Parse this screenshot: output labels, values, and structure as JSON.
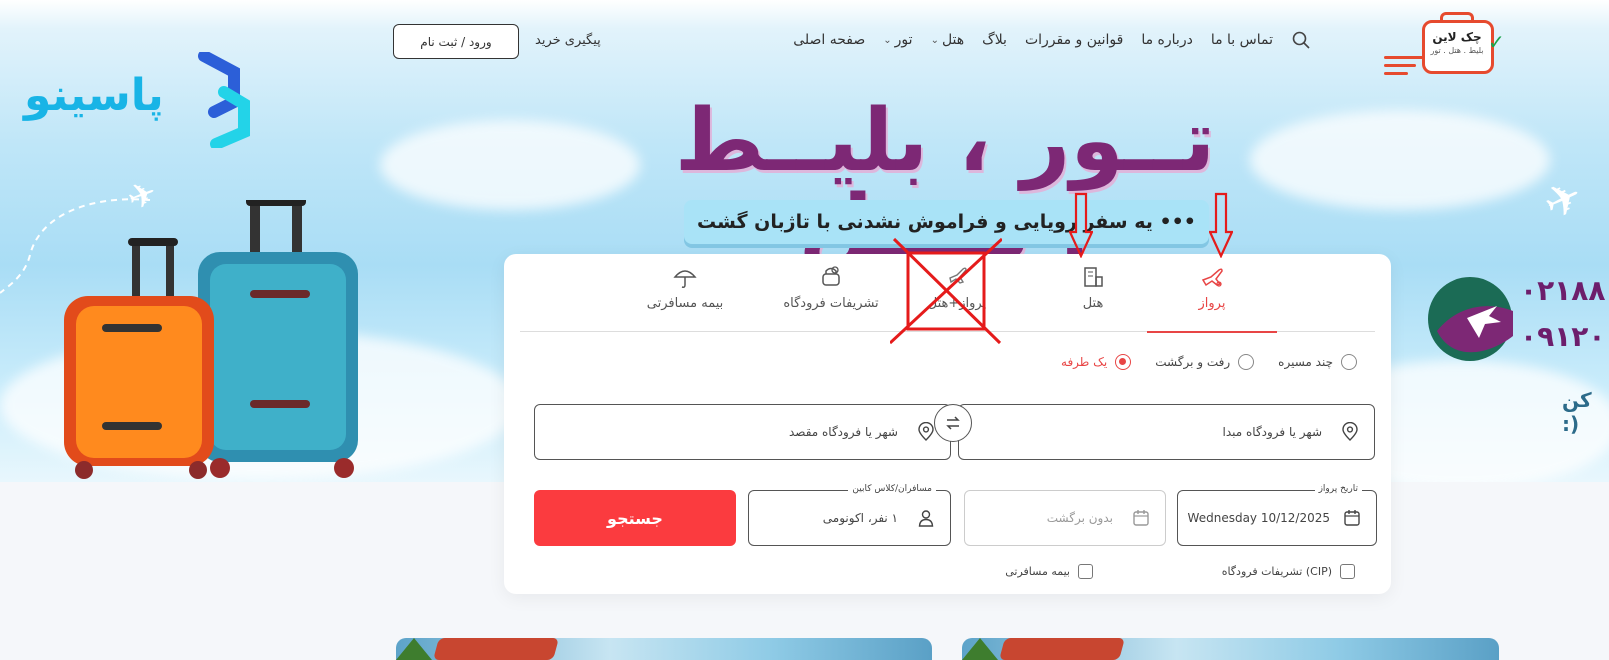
{
  "brand": {
    "logo_title": "چک لاین",
    "logo_sub": "بلیط . هتل . تور",
    "partner_logo": "پاسینو"
  },
  "nav": {
    "items": [
      {
        "label": "صفحه اصلی",
        "dropdown": false
      },
      {
        "label": "تور",
        "dropdown": true
      },
      {
        "label": "هتل",
        "dropdown": true
      },
      {
        "label": "بلاگ",
        "dropdown": false
      },
      {
        "label": "قوانین و مقررات",
        "dropdown": false
      },
      {
        "label": "درباره ما",
        "dropdown": false
      },
      {
        "label": "تماس با ما",
        "dropdown": false
      }
    ],
    "track_label": "پیگیری خرید",
    "login_label": "ورود / ثبت نام"
  },
  "hero": {
    "headline": "تــور ، بلیــط ، هتــل",
    "tagline": "••• یه سفر رویایی و فراموش نشدنی با تاژبان گشت •••",
    "phone1": "۰۲۱۸۸",
    "phone2": "۰۹۱۲۰",
    "call_text": "کن :)"
  },
  "search": {
    "tabs": [
      {
        "label": "پرواز",
        "icon": "flight-icon",
        "active": true
      },
      {
        "label": "هتل",
        "icon": "hotel-icon",
        "active": false
      },
      {
        "label": "پرواز+هتل",
        "icon": "flight-hotel-icon",
        "active": false
      },
      {
        "label": "تشریفات فرودگاه",
        "icon": "airport-service-icon",
        "active": false
      },
      {
        "label": "بیمه مسافرتی",
        "icon": "umbrella-icon",
        "active": false
      }
    ],
    "trip_types": [
      {
        "label": "یک طرفه",
        "checked": true
      },
      {
        "label": "رفت و برگشت",
        "checked": false
      },
      {
        "label": "چند مسیره",
        "checked": false
      }
    ],
    "origin_placeholder": "شهر یا فرودگاه مبدا",
    "destination_placeholder": "شهر یا فرودگاه مقصد",
    "departure_label": "تاریخ پرواز",
    "departure_value": "Wednesday 10/12/2025",
    "return_placeholder": "بدون برگشت",
    "passengers_label": "مسافران/کلاس کابین",
    "passengers_value": "۱ نفر، اکونومی",
    "search_button": "جستجو",
    "cip_label": "تشریفات فرودگاه (CIP)",
    "insurance_label": "بیمه مسافرتی"
  },
  "colors": {
    "accent": "#fb3b3f",
    "headline": "#7d2875",
    "brand_orange": "#e64a2e",
    "annotation": "#e51b1b"
  }
}
